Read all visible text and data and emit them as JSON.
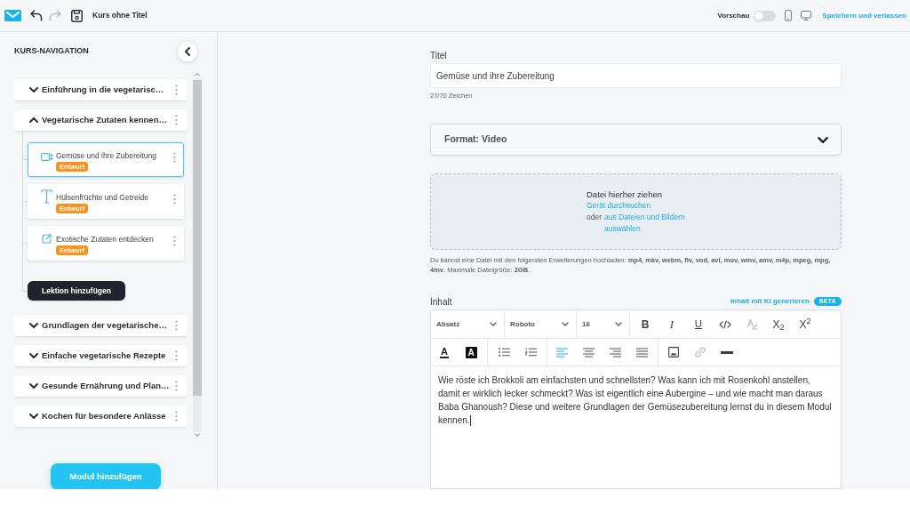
{
  "top_bar": {
    "history": [
      {
        "kind": "undo",
        "disabled": false
      },
      {
        "kind": "redo",
        "disabled": true
      }
    ],
    "title": "Kurs ohne Titel",
    "preview": {
      "label": "Vorschau",
      "on": false
    },
    "save_link": "Speichern und verlassen"
  },
  "sidebar": {
    "heading": "KURS-NAVIGATION",
    "modules": [
      {
        "title": "Einführung in die vegetarisc…",
        "expanded": false
      },
      {
        "title": "Vegetarische Zutaten kennen…",
        "expanded": true,
        "lessons": [
          {
            "kind": "video",
            "title": "Gemüse und ihre Zubereitung",
            "badge": "Entwurf",
            "selected": true
          },
          {
            "kind": "text",
            "title": "Hülsenfrüchte und Getreide",
            "badge": "Entwurf",
            "selected": false
          },
          {
            "kind": "link",
            "title": "Exotische Zutaten entdecken",
            "badge": "Entwurf",
            "selected": false
          }
        ],
        "add_lesson": "Lektion hinzufügen"
      },
      {
        "title": "Grundlagen der vegetarische…",
        "expanded": false
      },
      {
        "title": "Einfache vegetarische Rezepte",
        "expanded": false
      },
      {
        "title": "Gesunde Ernährung und Plan…",
        "expanded": false
      },
      {
        "title": "Kochen für besondere Anlässe",
        "expanded": false
      }
    ],
    "add_module": "Modul hinzufügen"
  },
  "main": {
    "title_field": {
      "label": "Titel",
      "value": "Gemüse und ihre Zubereitung",
      "counter": "27/70 Zeichen"
    },
    "format_select": {
      "value": "Format: Video",
      "expanded": false
    },
    "upload": {
      "heading": "Datei hierher ziehen",
      "browse_link": "Gerät durchsuchen",
      "or_label": "oder",
      "library_link": "aus Dateien und Bildern auswählen",
      "hint": "Du kannst eine Datei mit den folgenden Erweiterungen hochladen: **mp4, mkv, webm, flv, vod, avi, mov, wmv, amv, m4p, mpeg, mpg, 4mv**. Maximale Dateigröße: **2GB**."
    },
    "content": {
      "label": "Inhalt",
      "ai_link": "Inhalt mit KI generieren",
      "ai_badge": "BETA",
      "dropdowns": [
        {
          "value": "Absatz"
        },
        {
          "value": "Roboto"
        },
        {
          "value": "16"
        }
      ],
      "format_tools": [
        {
          "kind": "bold",
          "label": "B",
          "disabled": false
        },
        {
          "kind": "italic",
          "label": "I",
          "disabled": false
        },
        {
          "kind": "underline",
          "label": "U",
          "disabled": false
        },
        {
          "kind": "code",
          "disabled": false
        },
        {
          "kind": "clear_format",
          "disabled": true
        },
        {
          "kind": "subscript",
          "label": "X$_{2}$",
          "disabled": false
        },
        {
          "kind": "superscript",
          "label": "X$^{2}$",
          "disabled": false
        }
      ],
      "color_tools": [
        {
          "kind": "text_color",
          "label": "A"
        },
        {
          "kind": "highlight",
          "label": "A"
        }
      ],
      "list_tools": [
        {
          "kind": "bullets"
        },
        {
          "kind": "numbers"
        }
      ],
      "alignment": [
        {
          "kind": "left",
          "selected": true
        },
        {
          "kind": "center",
          "selected": false
        },
        {
          "kind": "right",
          "selected": false
        },
        {
          "kind": "justify",
          "selected": false
        }
      ],
      "insert_tools": [
        {
          "kind": "image",
          "disabled": false
        },
        {
          "kind": "link",
          "disabled": true
        },
        {
          "kind": "rule",
          "disabled": false
        }
      ],
      "body": "Wie röste ich Brokkoli am einfachsten und schnellsten? Was kann ich mit Rosenkohl anstellen, damit er wirklich lecker schmeckt? Was ist eigentlich eine Aubergine – und wie macht man daraus Baba Ghanoush? Diese und weitere Grundlagen der Gemüsezubereitung lernst du in diesem Modul kennen."
    }
  }
}
